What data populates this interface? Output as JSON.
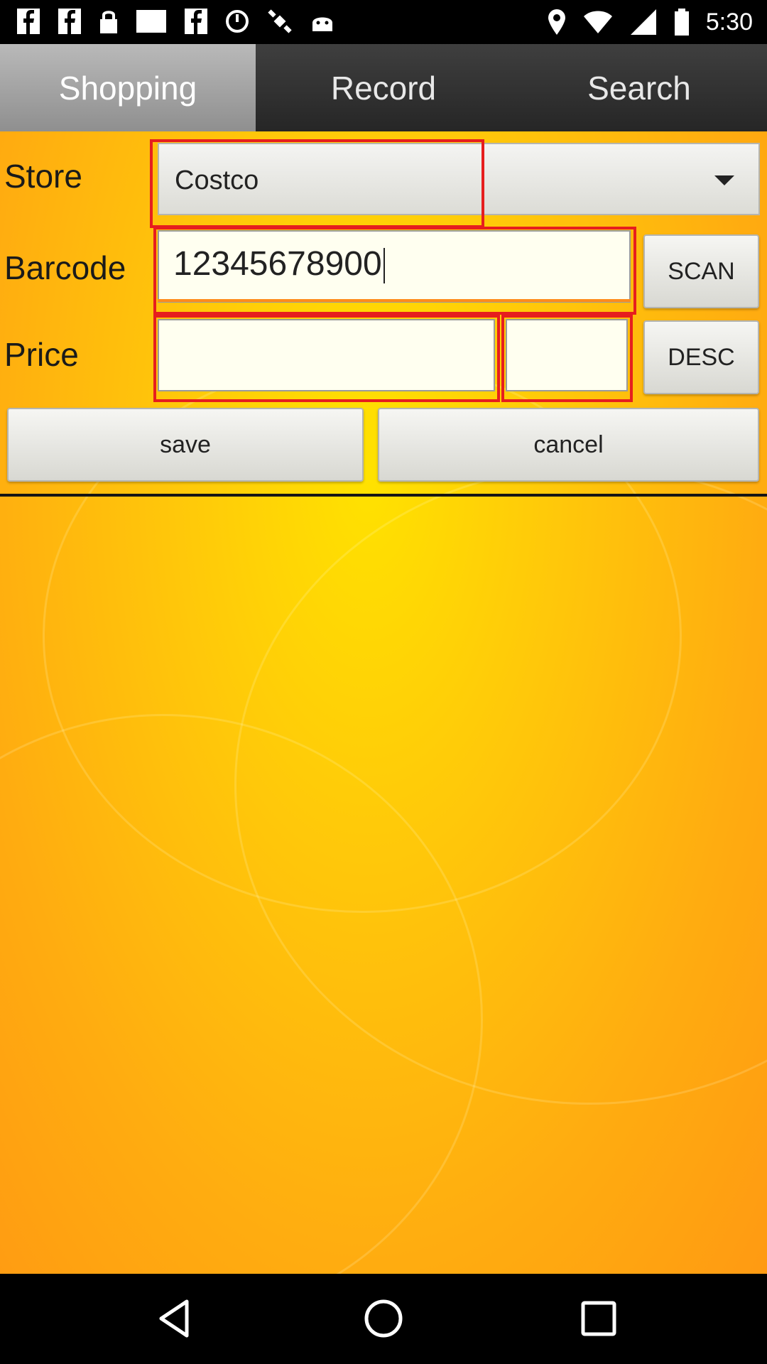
{
  "status_bar": {
    "time": "5:30",
    "left_icons": [
      "facebook-icon",
      "facebook-icon",
      "lock-icon",
      "blank-notification-icon",
      "facebook-icon",
      "alarm-icon",
      "fake-gps-icon",
      "android-icon"
    ],
    "right_icons": [
      "location-icon",
      "wifi-icon",
      "signal-icon",
      "battery-icon"
    ]
  },
  "tabs": [
    {
      "label": "Shopping",
      "active": true
    },
    {
      "label": "Record",
      "active": false
    },
    {
      "label": "Search",
      "active": false
    }
  ],
  "form": {
    "store_label": "Store",
    "store_value": "Costco",
    "barcode_label": "Barcode",
    "barcode_value": "12345678900",
    "price_label": "Price",
    "price_value": "",
    "price_extra_value": "",
    "scan_label": "SCAN",
    "desc_label": "DESC",
    "save_label": "save",
    "cancel_label": "cancel"
  },
  "nav_bar": {
    "icons": [
      "back-icon",
      "home-icon",
      "recents-icon"
    ]
  },
  "colors": {
    "highlight": "#e61e1e",
    "background_top": "#ffe200",
    "background_bottom": "#ff9a12"
  }
}
